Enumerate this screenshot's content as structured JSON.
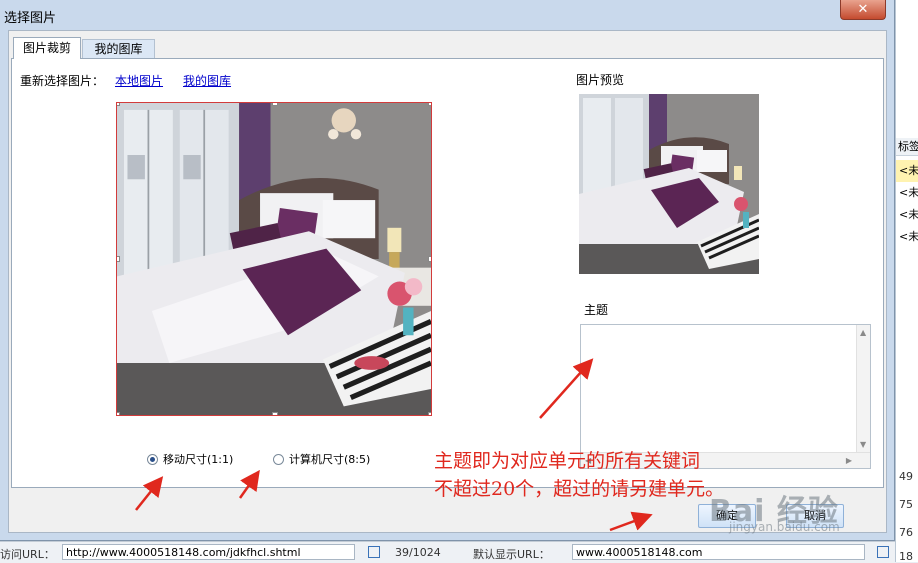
{
  "dialog": {
    "title": "选择图片",
    "close_symbol": "✕"
  },
  "tabs": [
    {
      "label": "图片裁剪",
      "active": true
    },
    {
      "label": "我的图库",
      "active": false
    }
  ],
  "reselect": {
    "label": "重新选择图片：",
    "link_local": "本地图片",
    "link_gallery": "我的图库"
  },
  "ratio_options": [
    {
      "label": "移动尺寸(1:1)",
      "checked": true
    },
    {
      "label": "计算机尺寸(8:5)",
      "checked": false
    }
  ],
  "preview": {
    "label": "图片预览"
  },
  "subject": {
    "label": "主题",
    "value": ""
  },
  "annotation": {
    "line1": "主题即为对应单元的所有关键词",
    "line2": "不超过20个，超过的请另建单元。"
  },
  "buttons": {
    "ok": "确定",
    "cancel": "取消"
  },
  "watermark": {
    "brand": "Bai 经验",
    "url": "jingyan.baidu.com"
  },
  "background": {
    "right_header": "标签",
    "right_rows": [
      "<未",
      "<未",
      "<未",
      "<未"
    ],
    "right_numbers": [
      "49",
      "75",
      "76",
      "18"
    ],
    "bottom": {
      "url_label": "访问URL：",
      "url_value": "http://www.4000518148.com/jdkfhcl.shtml",
      "counter": "39/1024",
      "display_url_label": "默认显示URL：",
      "display_url_value": "www.4000518148.com"
    }
  },
  "colors": {
    "annotation": "#e0281e",
    "crop_border": "#d23b3b",
    "link": "#0000cc",
    "accent": "#2a4f8a"
  }
}
